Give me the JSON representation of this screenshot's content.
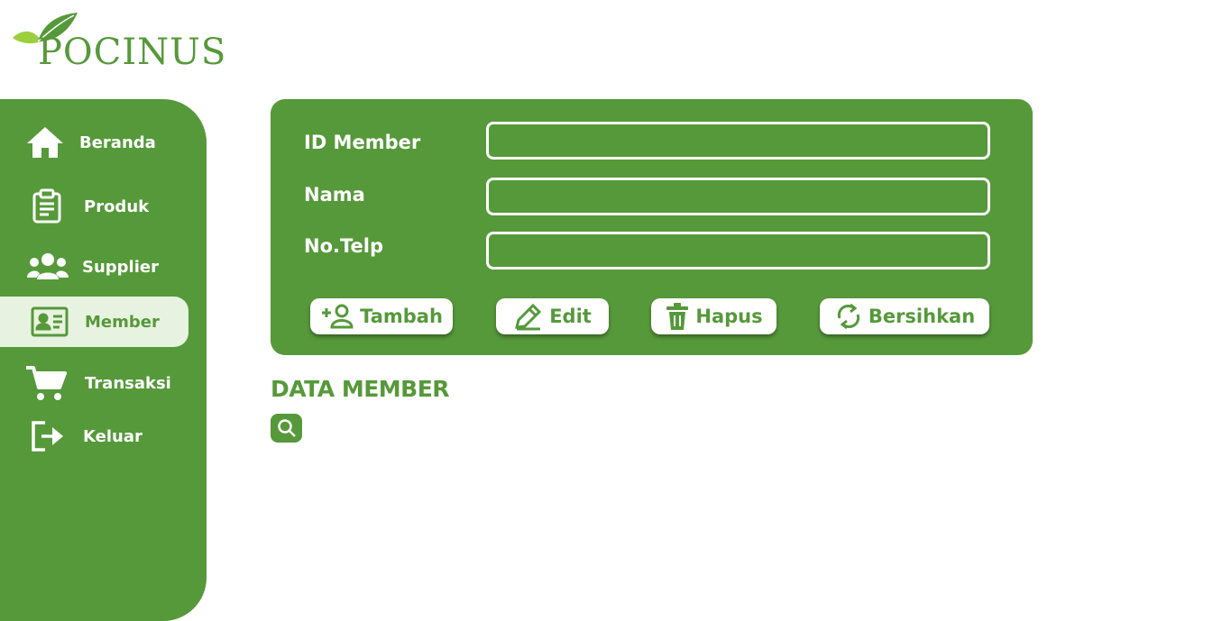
{
  "app": {
    "logo_text": "POCINUS"
  },
  "sidebar": {
    "items": [
      {
        "label": "Beranda",
        "icon": "home-icon",
        "active": false
      },
      {
        "label": "Produk",
        "icon": "clipboard-icon",
        "active": false
      },
      {
        "label": "Supplier",
        "icon": "users-icon",
        "active": false
      },
      {
        "label": "Member",
        "icon": "id-card-icon",
        "active": true
      },
      {
        "label": "Transaksi",
        "icon": "cart-icon",
        "active": false
      },
      {
        "label": "Keluar",
        "icon": "logout-icon",
        "active": false
      }
    ]
  },
  "form": {
    "fields": [
      {
        "label": "ID Member",
        "value": ""
      },
      {
        "label": "Nama",
        "value": ""
      },
      {
        "label": "No.Telp",
        "value": ""
      }
    ],
    "buttons": {
      "add": "Tambah",
      "edit": "Edit",
      "delete": "Hapus",
      "clear": "Bersihkan"
    }
  },
  "data_section": {
    "title": "DATA MEMBER",
    "search_icon": "search-icon"
  },
  "colors": {
    "primary": "#56993a",
    "active_bg": "#e8f2e1",
    "logo_leaf_light": "#9ccf3e"
  }
}
